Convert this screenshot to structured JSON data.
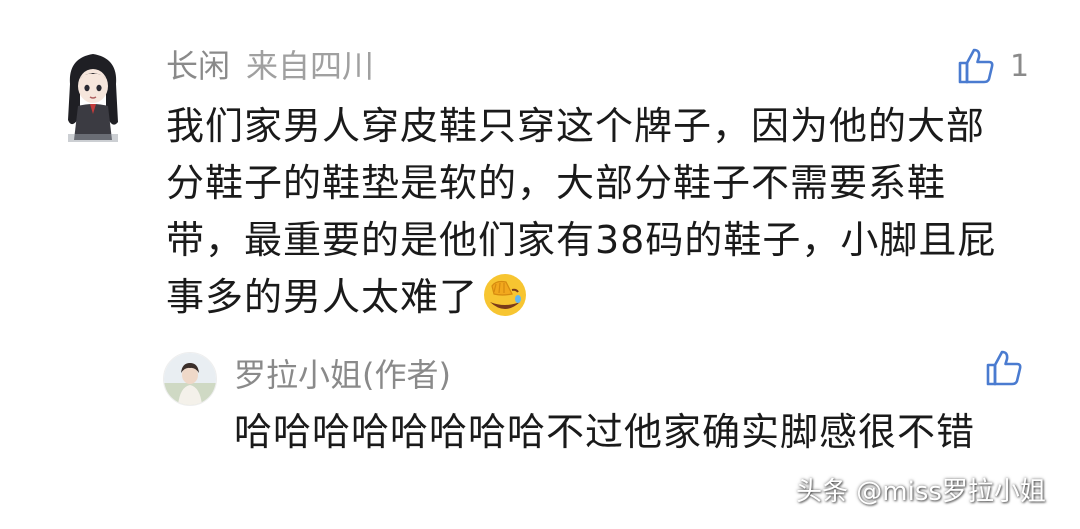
{
  "comment": {
    "username": "长闲",
    "location": "来自四川",
    "likes": "1",
    "text": "我们家男人穿皮鞋只穿这个牌子，因为他的大部分鞋子的鞋垫是软的，大部分鞋子不需要系鞋带，最重要的是他们家有38码的鞋子，小脚且屁事多的男人太难了",
    "emoji": "facepalm-laughing-emoji"
  },
  "reply": {
    "author": "罗拉小姐(作者)",
    "text": "哈哈哈哈哈哈哈哈不过他家确实脚感很不错"
  },
  "watermark": {
    "text": "头条 @miss罗拉小姐"
  },
  "icons": {
    "like": "thumbs-up-icon",
    "avatar": "anime-girl-avatar"
  },
  "colors": {
    "meta_text": "#8a8a8a",
    "body_text": "#1a1a1a",
    "like_icon": "#4a7bd0"
  }
}
